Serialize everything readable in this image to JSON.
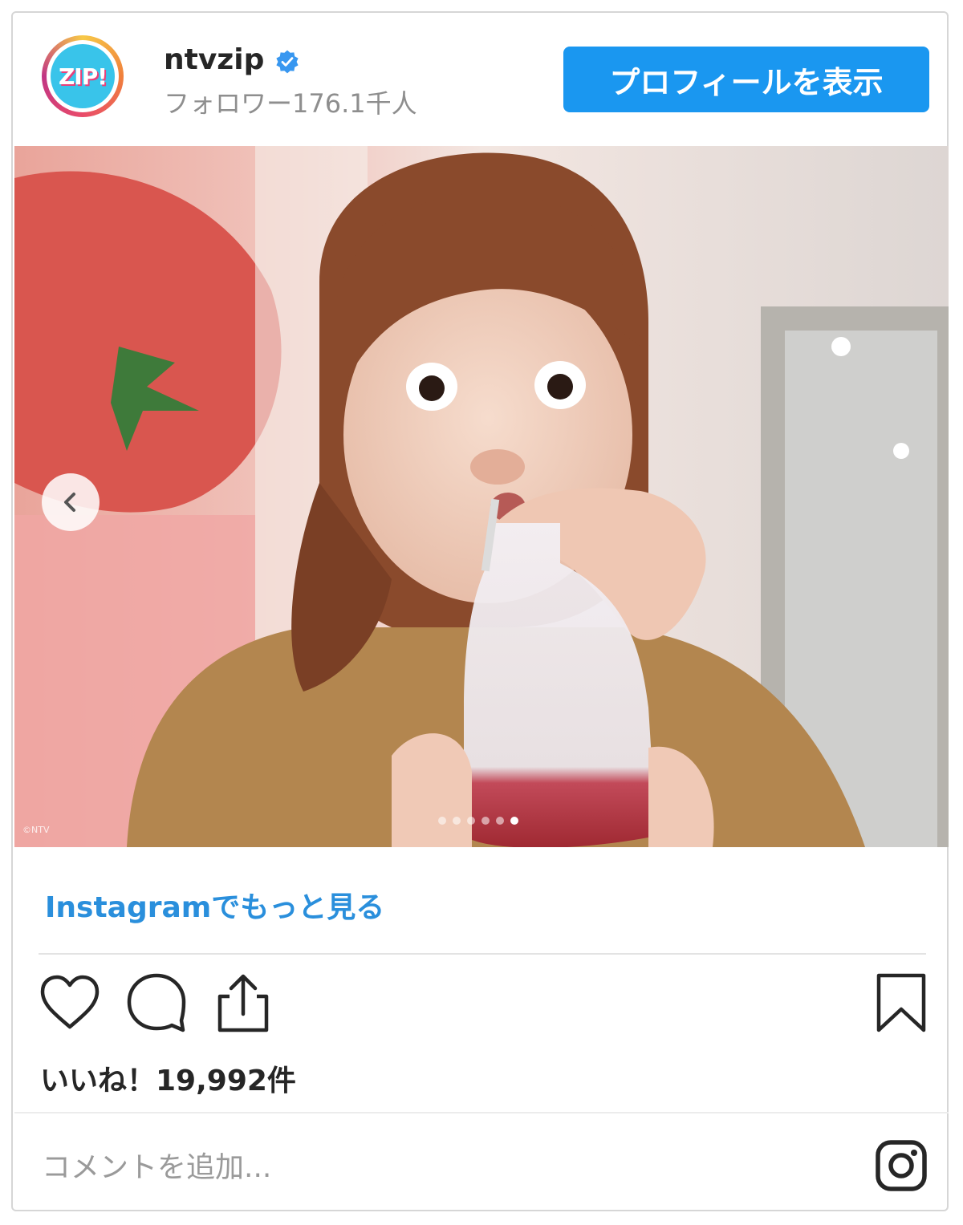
{
  "post": {
    "username": "ntvzip",
    "followers": "フォロワー176.1千人",
    "avatar_text": "ZIP!",
    "profile_button": "プロフィールを表示",
    "photo_watermark": "©NTV",
    "more_link": "Instagramでもっと見る",
    "likes": "いいね！19,992件",
    "comment_placeholder": "コメントを追加...",
    "carousel": {
      "total": 6,
      "active_index": 5
    }
  },
  "icons": {
    "verified": "verified-badge-icon",
    "prev": "chevron-left-icon",
    "like": "heart-icon",
    "comment": "comment-bubble-icon",
    "share": "share-icon",
    "save": "bookmark-icon",
    "instagram": "instagram-icon"
  },
  "colors": {
    "button_blue": "#1a97f0",
    "link_blue": "#2a8fdc",
    "avatar_cyan": "#39c4ea",
    "text_dark": "#262626",
    "text_muted": "#8e8e8e"
  }
}
